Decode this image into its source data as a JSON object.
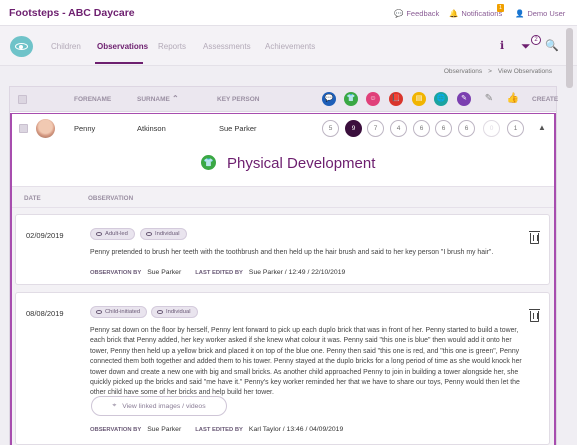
{
  "app": {
    "title": "Footsteps - ABC Daycare"
  },
  "topbar": {
    "feedback": "Feedback",
    "notifications": "Notifications",
    "notifications_count": "1",
    "user": "Demo User"
  },
  "nav": {
    "tabs": [
      "Children",
      "Observations",
      "Reports",
      "Assessments",
      "Achievements"
    ],
    "active_tab": "Observations",
    "filter_count": "2"
  },
  "breadcrumb": {
    "parent": "Observations",
    "separator": ">",
    "current": "View Observations"
  },
  "table": {
    "headers": {
      "forename": "FORENAME",
      "surname": "SURNAME",
      "key_person": "KEY PERSON",
      "create": "CREATE"
    },
    "area_icon_colors": [
      "#1e5fb8",
      "#3aa844",
      "#e0407a",
      "#d9352c",
      "#f1b400",
      "#1ba3a0",
      "#7b3fb0",
      "#9a9a9a",
      "#9a9a9a"
    ],
    "row": {
      "forename": "Penny",
      "surname": "Atkinson",
      "key_person": "Sue Parker",
      "counts": [
        "5",
        "9",
        "7",
        "4",
        "6",
        "6",
        "6",
        "0",
        "1"
      ],
      "active_index": 1
    }
  },
  "detail": {
    "area_title": "Physical Development",
    "headers": {
      "date": "DATE",
      "observation": "OBSERVATION"
    },
    "labels": {
      "observation_by": "OBSERVATION BY",
      "last_edited_by": "LAST EDITED BY",
      "linked_button": "View linked images / videos"
    },
    "observations": [
      {
        "date": "02/09/2019",
        "tags": [
          "Adult-led",
          "Individual"
        ],
        "text": "Penny pretended to brush her teeth with the toothbrush and then held up the hair brush and said to her key person \"I brush my hair\".",
        "observation_by": "Sue Parker",
        "last_edited": "Sue Parker / 12:49 / 22/10/2019"
      },
      {
        "date": "08/08/2019",
        "tags": [
          "Child-initiated",
          "Individual"
        ],
        "text": "Penny sat down on the floor by herself, Penny lent forward to pick up each duplo brick that was in front of her. Penny started to build a tower, each brick that Penny added, her key worker asked if she knew what colour it was. Penny said \"this one is blue\" then would add it onto her tower, Penny then held up a yellow brick and placed it on top of the blue one. Penny then said \"this one is red, and \"this one is green\", Penny connected them both together and added them to his tower. Penny stayed at the duplo bricks for a long period of time as she would knock her tower down and create a new one with big and small bricks. As another child approached Penny to join in building a tower alongside her, she quickly picked up the bricks and said \"me have it.\" Penny's key worker reminded her that we have to share our toys, Penny would then let the other child have some of her bricks and help build her tower.",
        "observation_by": "Sue Parker",
        "last_edited": "Karl Taylor / 13:46 / 04/09/2019"
      }
    ]
  }
}
